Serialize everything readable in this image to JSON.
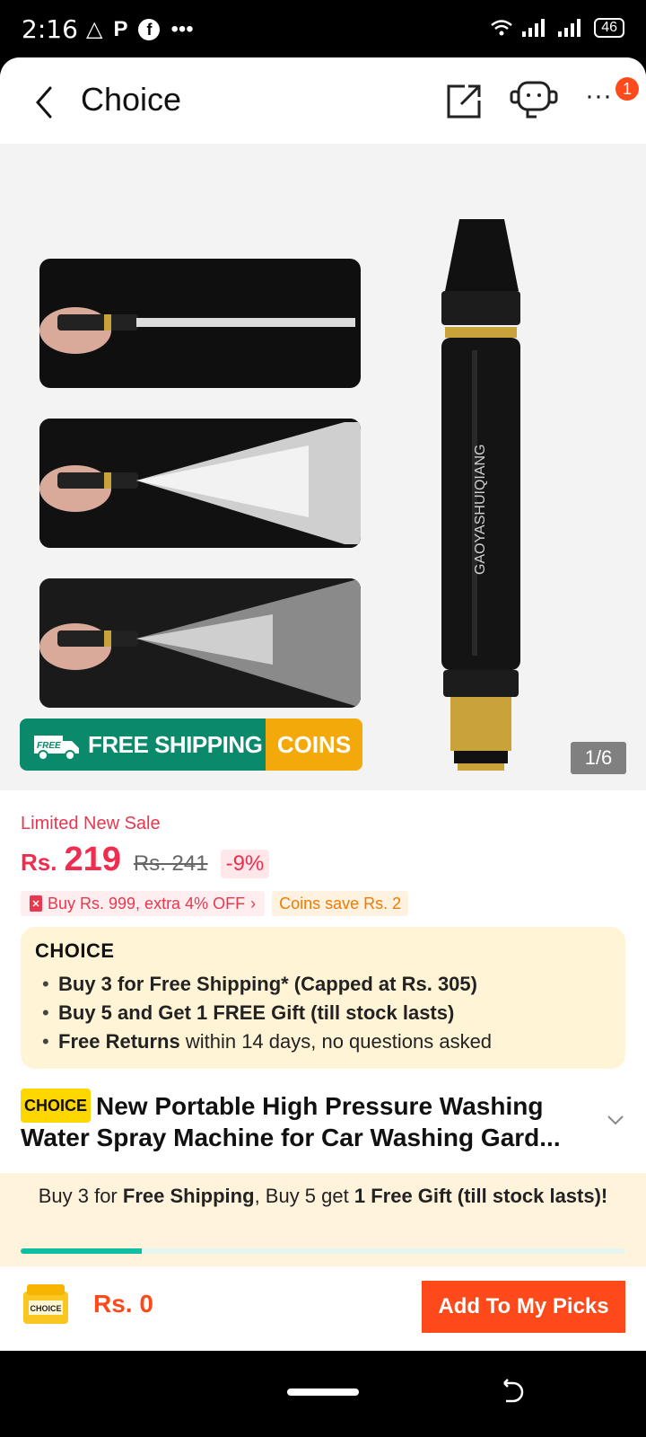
{
  "status_bar": {
    "time": "2:16",
    "left_icons": [
      "alert-icon",
      "parking-icon",
      "facebook-icon",
      "more-dots"
    ],
    "battery": "46"
  },
  "header": {
    "title": "Choice",
    "notification_count": "1",
    "more_label": "···"
  },
  "gallery": {
    "counter": "1/6",
    "banner_free_badge": "FREE",
    "banner_free_shipping": "FREE SHIPPING",
    "banner_coins": "COINS",
    "product_imprint": "GAOYASHUIQIANG"
  },
  "price": {
    "sale_label": "Limited New Sale",
    "currency": "Rs.",
    "current": "219",
    "original": "Rs. 241",
    "discount": "-9%",
    "promo": "Buy Rs. 999, extra 4% OFF",
    "coins": "Coins save Rs. 2"
  },
  "choice_card": {
    "logo": "CHOICE",
    "items": [
      {
        "bold": "Buy 3 for  Free Shipping* (Capped at Rs. 305)",
        "rest": ""
      },
      {
        "bold": "Buy 5 and Get 1 FREE Gift (till stock lasts)",
        "rest": ""
      },
      {
        "bold": "Free Returns",
        "rest": " within 14 days, no questions asked"
      }
    ]
  },
  "product": {
    "tag": "CHOICE",
    "title": "New Portable High Pressure Washing Water Spray Machine for Car Washing Gard..."
  },
  "ship_promo": {
    "part1": "Buy 3 for ",
    "bold1": "Free Shipping",
    "part2": ", Buy 5 get ",
    "bold2": "1 Free Gift (till stock lasts)!",
    "progress": 0.2
  },
  "bottom_bar": {
    "cart_label": "CHOICE",
    "total": "Rs. 0",
    "add_button": "Add To My Picks"
  },
  "colors": {
    "accent": "#fe4a1b",
    "price": "#f02d4f",
    "choice_bg": "#fff4d6",
    "progress": "#0fbfa5"
  }
}
